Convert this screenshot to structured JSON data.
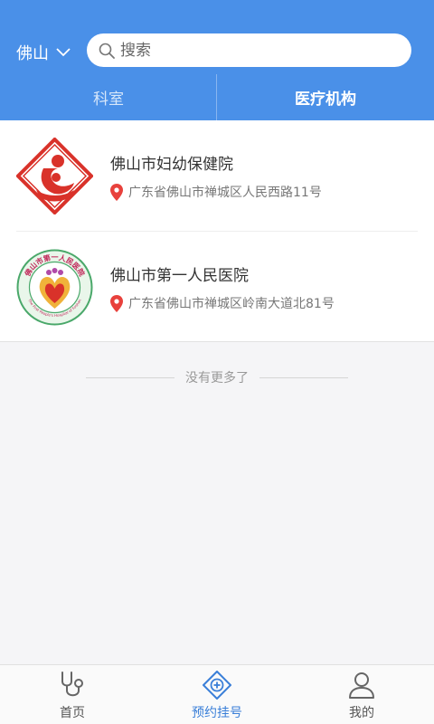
{
  "header": {
    "city": "佛山",
    "search": {
      "placeholder": "搜索",
      "value": ""
    },
    "tabs": [
      {
        "label": "科室",
        "active": false
      },
      {
        "label": "医疗机构",
        "active": true
      }
    ]
  },
  "hospitals": [
    {
      "name": "佛山市妇幼保健院",
      "address": "广东省佛山市禅城区人民西路11号",
      "logo_icon": "maternal-child-hospital-logo"
    },
    {
      "name": "佛山市第一人民医院",
      "address": "广东省佛山市禅城区岭南大道北81号",
      "logo_icon": "first-peoples-hospital-logo",
      "logo_text": "佛山市第一人民医院",
      "logo_subtext": "The First People's Hospital of Foshan"
    }
  ],
  "list_footer": "没有更多了",
  "bottom_nav": [
    {
      "label": "首页",
      "icon": "stethoscope-icon",
      "active": false
    },
    {
      "label": "预约挂号",
      "icon": "appointment-plus-icon",
      "active": true
    },
    {
      "label": "我的",
      "icon": "user-icon",
      "active": false
    }
  ],
  "colors": {
    "primary": "#4a90e8",
    "accent": "#3a7fd8",
    "pin": "#e8413c",
    "logo_red": "#d9322a"
  }
}
